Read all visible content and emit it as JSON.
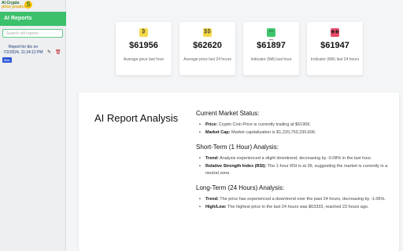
{
  "logo": {
    "line1": "AI Crypto",
    "line2": "price predictor",
    "mark": "S"
  },
  "sidebar": {
    "title": "AI Reports",
    "search_placeholder": "Search old reports",
    "report": {
      "line1": "Report for btc on",
      "line2": "7/2/2024, 11:24:12 PM"
    },
    "tag": "#btc",
    "edit_icon": "✎",
    "delete_icon": "🗑"
  },
  "cards": [
    {
      "icon": "₿",
      "icon_color": "#f5d94a",
      "value": "$61956",
      "label": "Average price last hour"
    },
    {
      "icon": "₿₿",
      "icon_color": "#f5d94a",
      "value": "$62620",
      "label": "Average price last 24 hours"
    },
    {
      "icon": "ꟷ ꟷ",
      "icon_color": "#3ec46d",
      "value": "$61897",
      "label": "Indicator (MA) last hour"
    },
    {
      "icon": "◉◉",
      "icon_color": "#e94a6a",
      "value": "$61947",
      "label": "Indicator (MA) last 24 hours"
    }
  ],
  "panel": {
    "title": "AI Report Analysis",
    "sections": [
      {
        "heading": "Current Market Status:",
        "items": [
          {
            "label": "Price:",
            "text": " Crypto Coin Price is currently trading at $61906."
          },
          {
            "label": "Market Cap:",
            "text": " Market capitalization is $1,220,753,230,606."
          }
        ]
      },
      {
        "heading": "Short-Term (1 Hour) Analysis:",
        "items": [
          {
            "label": "Trend:",
            "text": " Analysis experienced a slight downtrend, decreasing by -0.08% in the last hour."
          },
          {
            "label": "Relative Strength Index (RSI):",
            "text": " The 1-hour RSI is at 39, suggesting the market is currently in a neutral zone."
          }
        ]
      },
      {
        "heading": "Long-Term (24 Hours) Analysis:",
        "items": [
          {
            "label": "Trend:",
            "text": " The price has experienced a downtrend over the past 24 hours, decreasing by -1.06%."
          },
          {
            "label": "High/Low:",
            "text": " The highest price in the last 24 hours was $63333, reached 23 hours ago."
          }
        ]
      }
    ]
  }
}
